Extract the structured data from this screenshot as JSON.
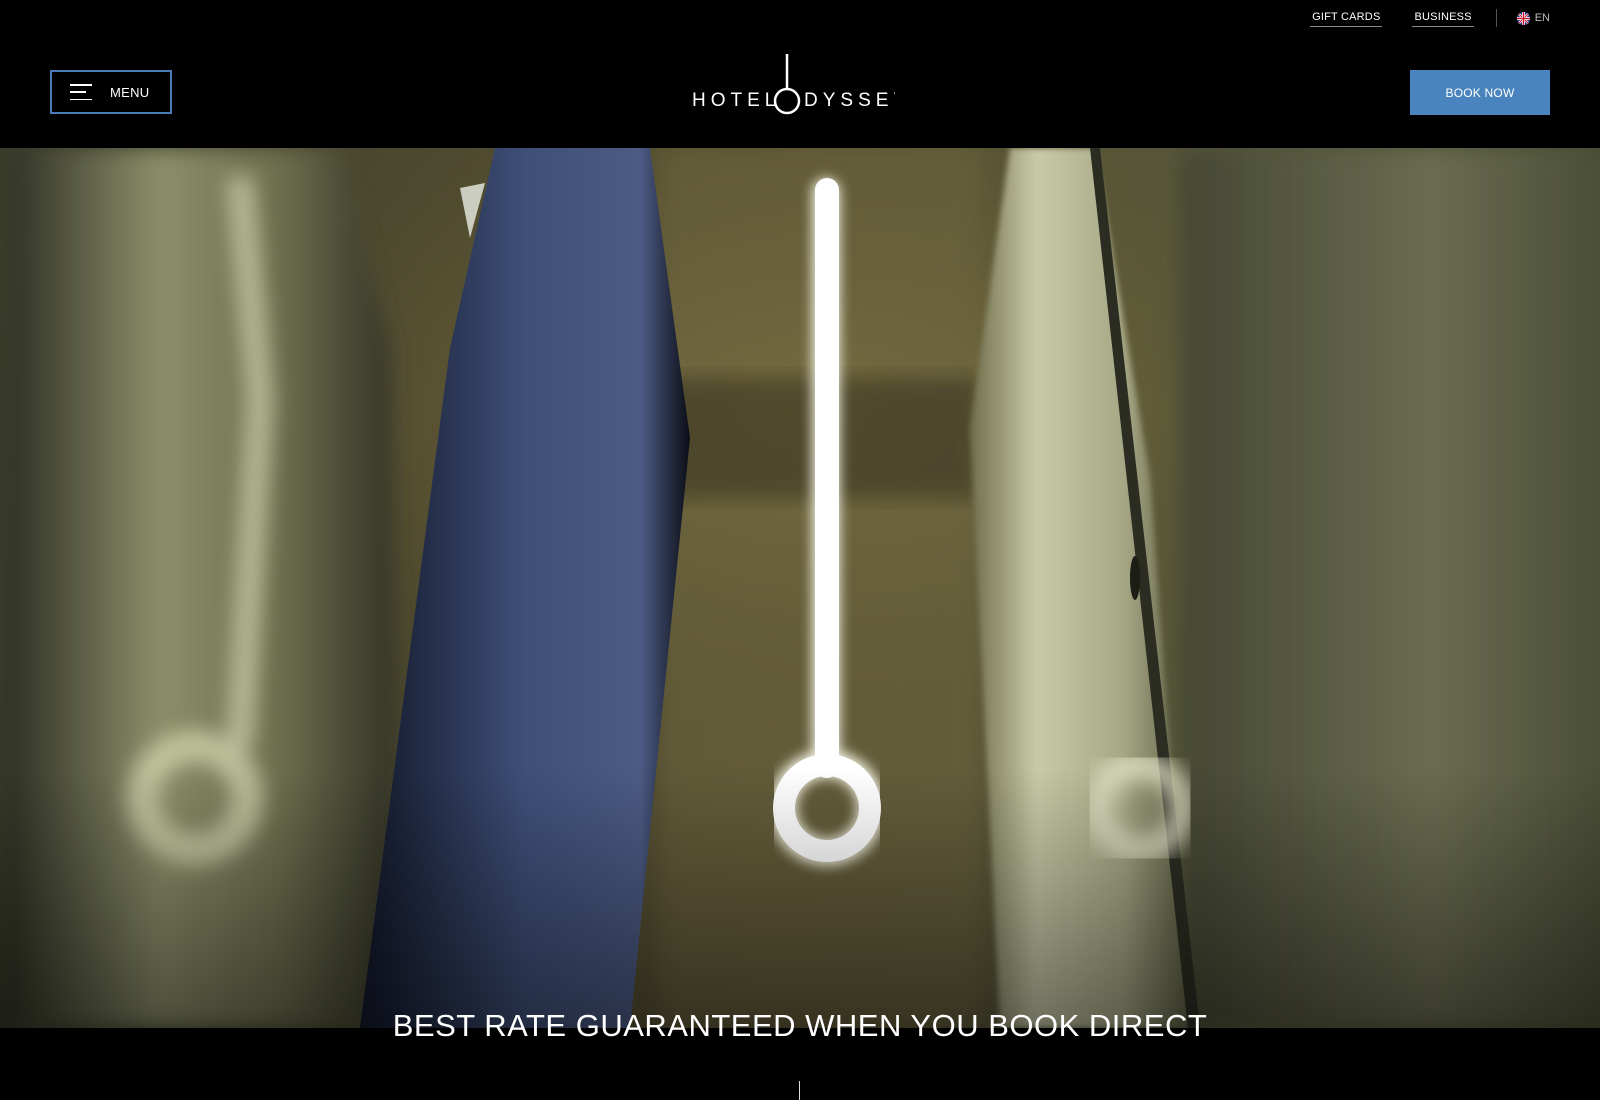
{
  "utility": {
    "gift_cards": "GIFT CARDS",
    "business": "BUSINESS",
    "language": "EN",
    "flag_icon": "uk-flag-icon"
  },
  "header": {
    "menu_label": "MENU",
    "menu_icon": "hamburger-icon",
    "logo_left": "HOTEL",
    "logo_right": "DYSSEY",
    "book_label": "BOOK NOW"
  },
  "hero": {
    "tagline": "BEST RATE GUARANTEED WHEN YOU BOOK DIRECT"
  },
  "colors": {
    "background": "#000000",
    "accent_blue": "#4a84bf",
    "menu_border": "#4a7bb8"
  }
}
